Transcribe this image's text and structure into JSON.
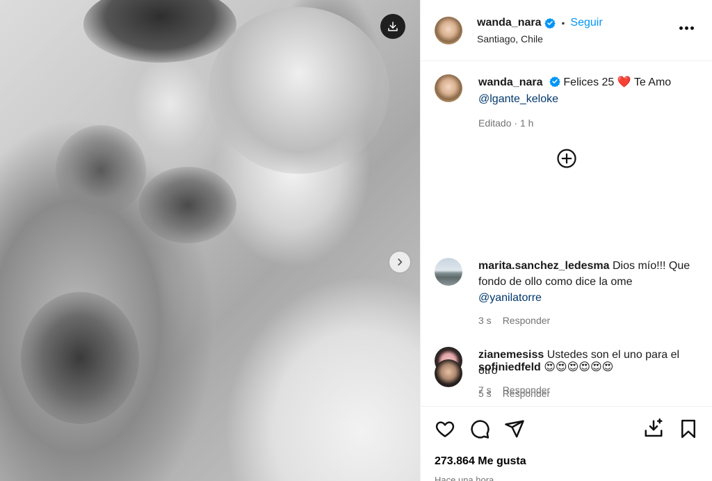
{
  "post": {
    "username": "wanda_nara",
    "follow_label": "Seguir",
    "separator": "•",
    "location": "Santiago, Chile"
  },
  "caption": {
    "username": "wanda_nara",
    "text": "Felices 25",
    "heart": "❤️",
    "text_after": "Te Amo",
    "mention": "@lgante_keloke",
    "edited": "Editado",
    "time": "1 h"
  },
  "comments": [
    {
      "username": "marita.sanchez_ledesma",
      "text": "Dios mío!!! Que fondo de ollo como dice la ome",
      "mention": "@yanilatorre",
      "time": "3 s",
      "reply_label": "Responder"
    },
    {
      "username": "zianemesiss",
      "text": "Ustedes son el uno para el otro",
      "time": "5 s",
      "reply_label": "Responder"
    },
    {
      "username": "sofiniedfeld",
      "text": "😍😍😍😍😍😍",
      "time": "7 s",
      "reply_label": "Responder"
    }
  ],
  "likes": "273.864 Me gusta",
  "posted": "Hace una hora",
  "colors": {
    "accent": "#0095f6",
    "verified": "#0095f6",
    "heart": "#e3262b",
    "muted": "#737373"
  },
  "icons": [
    "download-icon",
    "chevron-right-icon",
    "verified-icon",
    "more-icon",
    "plus-circle-icon",
    "heart-icon",
    "comment-icon",
    "share-icon",
    "save-to-collection-icon",
    "bookmark-icon"
  ]
}
